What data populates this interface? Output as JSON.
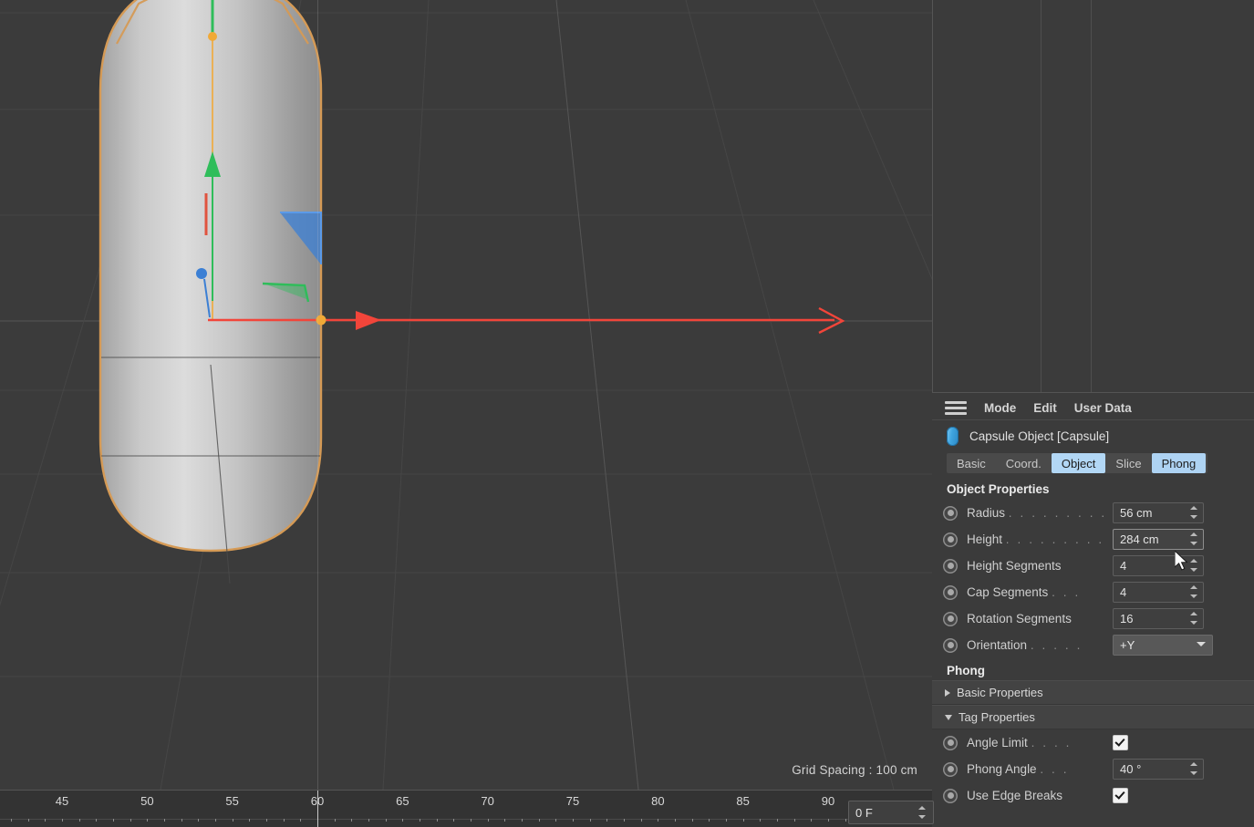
{
  "viewport": {
    "grid_spacing_label": "Grid Spacing : 100 cm",
    "background_color": "#3b3b3b",
    "grid_line_color": "#4c4c4c",
    "object": {
      "name": "Capsule",
      "selection_outline_color": "#d59a55",
      "surface_light": "#d8d8d8",
      "surface_dark": "#9a9a9a"
    },
    "gizmo": {
      "x_axis_color": "#f2453a",
      "y_axis_color": "#2fbd5a",
      "z_axis_color": "#3b7fd4",
      "handle_color": "#f0a937"
    }
  },
  "object_manager": {},
  "attributes": {
    "menu": {
      "hamburger_icon": "hamburger-icon",
      "items": [
        "Mode",
        "Edit",
        "User Data"
      ]
    },
    "object_header": {
      "icon": "capsule-icon",
      "title": "Capsule Object [Capsule]"
    },
    "tabs": [
      {
        "label": "Basic",
        "state": "normal"
      },
      {
        "label": "Coord.",
        "state": "normal"
      },
      {
        "label": "Object",
        "state": "selected"
      },
      {
        "label": "Slice",
        "state": "normal"
      },
      {
        "label": "Phong",
        "state": "highlight"
      }
    ],
    "object_properties": {
      "title": "Object Properties",
      "rows": [
        {
          "label": "Radius",
          "dots": ". . . . . . . . .",
          "type": "number",
          "value": "56 cm",
          "hot": false
        },
        {
          "label": "Height",
          "dots": ". . . . . . . . .",
          "type": "number",
          "value": "284 cm",
          "hot": true
        },
        {
          "label": "Height Segments",
          "dots": "",
          "type": "number",
          "value": "4",
          "hot": false
        },
        {
          "label": "Cap Segments",
          "dots": ". . .",
          "type": "number",
          "value": "4",
          "hot": false
        },
        {
          "label": "Rotation Segments",
          "dots": "",
          "type": "number",
          "value": "16",
          "hot": false
        },
        {
          "label": "Orientation",
          "dots": ". . . . .",
          "type": "select",
          "value": "+Y",
          "hot": false
        }
      ]
    },
    "phong": {
      "title": "Phong",
      "basic_properties": {
        "label": "Basic Properties",
        "expanded": false
      },
      "tag_properties": {
        "label": "Tag Properties",
        "expanded": true
      },
      "rows": [
        {
          "label": "Angle Limit",
          "dots": ". . . .",
          "type": "check",
          "value": "checked"
        },
        {
          "label": "Phong Angle",
          "dots": ". . .",
          "type": "number",
          "value": "40 °"
        },
        {
          "label": "Use Edge Breaks",
          "dots": "",
          "type": "check",
          "value": "checked"
        }
      ]
    }
  },
  "timeline": {
    "frame_ticks": [
      45,
      50,
      55,
      60,
      65,
      70,
      75,
      80,
      85,
      90
    ],
    "playhead_frame": 60,
    "current_frame_field": "0 F"
  }
}
